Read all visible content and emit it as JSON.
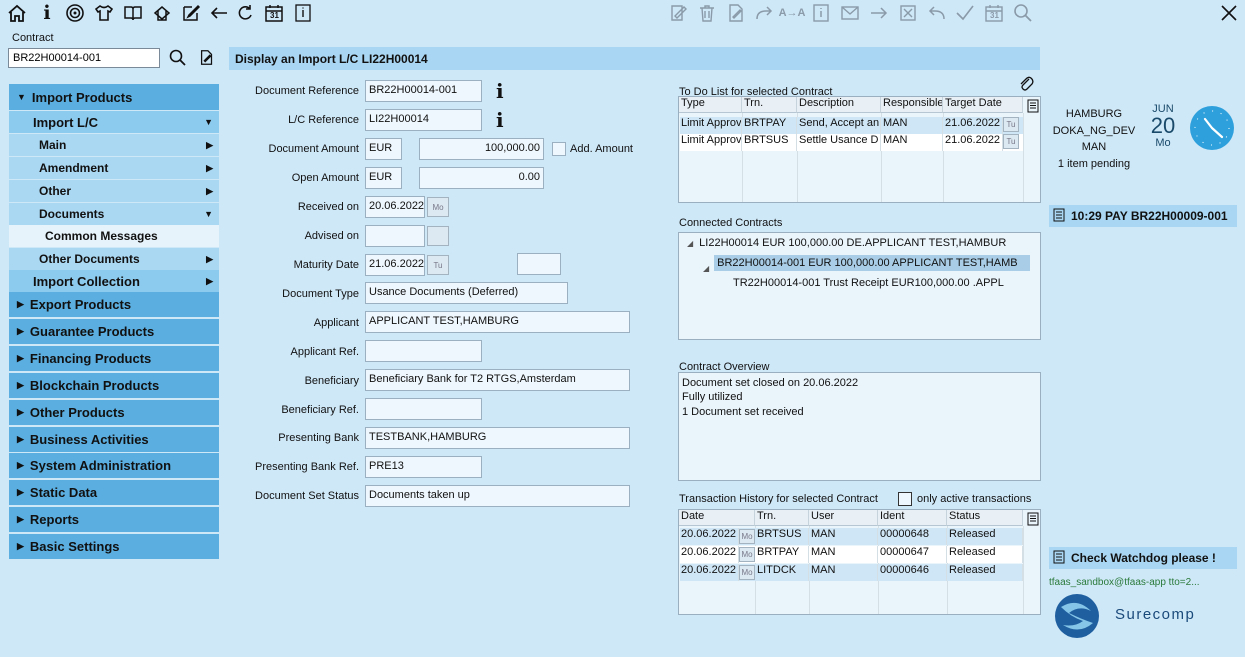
{
  "toolbar": {
    "icons": [
      "home-icon",
      "info-icon",
      "target-icon",
      "tshirt-icon",
      "book-icon",
      "layers-icon",
      "edit-icon",
      "back-arrow-icon",
      "refresh-icon",
      "calendar-icon",
      "notes-icon"
    ],
    "right_icons": [
      "sign-icon",
      "trash-icon",
      "document-sign-icon",
      "forward-icon",
      "transfer-icon",
      "info-doc-icon",
      "mail-icon",
      "arrow-right-icon",
      "cancel-box-icon",
      "undo-icon",
      "check-icon",
      "calendar-31-icon",
      "search-icon"
    ],
    "close_icon": "close-icon",
    "calendar_day": "31"
  },
  "contract": {
    "label": "Contract",
    "value": "BR22H00014-001"
  },
  "nav": {
    "import_products": "Import Products",
    "import_lc": "Import L/C",
    "main": "Main",
    "amendment": "Amendment",
    "other": "Other",
    "documents": "Documents",
    "common_messages": "Common Messages",
    "other_documents": "Other Documents",
    "import_collection": "Import Collection",
    "export_products": "Export Products",
    "guarantee_products": "Guarantee Products",
    "financing_products": "Financing Products",
    "blockchain_products": "Blockchain Products",
    "other_products": "Other Products",
    "business_activities": "Business Activities",
    "system_administration": "System Administration",
    "static_data": "Static Data",
    "reports": "Reports",
    "basic_settings": "Basic Settings"
  },
  "title": "Display an Import L/C LI22H00014",
  "form": {
    "doc_ref_label": "Document Reference",
    "doc_ref_value": "BR22H00014-001",
    "lc_ref_label": "L/C Reference",
    "lc_ref_value": "LI22H00014",
    "doc_amount_label": "Document Amount",
    "doc_amount_ccy": "EUR",
    "doc_amount_value": "100,000.00",
    "add_amount_label": "Add. Amount",
    "open_amount_label": "Open Amount",
    "open_amount_ccy": "EUR",
    "open_amount_value": "0.00",
    "received_label": "Received on",
    "received_value": "20.06.2022",
    "received_day": "Mo",
    "advised_label": "Advised on",
    "maturity_label": "Maturity Date",
    "maturity_value": "21.06.2022",
    "maturity_day": "Tu",
    "doc_type_label": "Document Type",
    "doc_type_value": "Usance Documents (Deferred)",
    "applicant_label": "Applicant",
    "applicant_value": "APPLICANT TEST,HAMBURG",
    "applicant_ref_label": "Applicant Ref.",
    "beneficiary_label": "Beneficiary",
    "beneficiary_value": "Beneficiary Bank for T2 RTGS,Amsterdam",
    "beneficiary_ref_label": "Beneficiary Ref.",
    "presenting_bank_label": "Presenting Bank",
    "presenting_bank_value": "TESTBANK,HAMBURG",
    "presenting_bank_ref_label": "Presenting Bank Ref.",
    "presenting_bank_ref_value": "PRE13",
    "doc_set_status_label": "Document Set Status",
    "doc_set_status_value": "Documents taken up"
  },
  "todo": {
    "label": "To Do List for selected Contract",
    "headers": [
      "Type",
      "Trn.",
      "Description",
      "Responsible",
      "Target Date"
    ],
    "rows": [
      {
        "type": "Limit Approv",
        "trn": "BRTPAY",
        "desc": "Send, Accept an",
        "resp": "MAN",
        "date": "21.06.2022",
        "day": "Tu"
      },
      {
        "type": "Limit Approv",
        "trn": "BRTSUS",
        "desc": "Settle Usance D",
        "resp": "MAN",
        "date": "21.06.2022",
        "day": "Tu"
      }
    ]
  },
  "connected": {
    "label": "Connected Contracts",
    "row1": "LI22H00014 EUR 100,000.00 DE.APPLICANT TEST,HAMBUR",
    "row2": "BR22H00014-001 EUR 100,000.00 APPLICANT TEST,HAMB",
    "row3": "TR22H00014-001 Trust Receipt EUR100,000.00 .APPL"
  },
  "overview": {
    "label": "Contract Overview",
    "line1": "Document set closed on 20.06.2022",
    "line2": "Fully utilized",
    "line3": "1 Document set received"
  },
  "history": {
    "label": "Transaction History for selected Contract",
    "only_active_label": "only active transactions",
    "headers": [
      "Date",
      "Trn.",
      "User",
      "Ident",
      "Status"
    ],
    "rows": [
      {
        "date": "20.06.2022",
        "day": "Mo",
        "trn": "BRTSUS",
        "user": "MAN",
        "ident": "00000648",
        "status": "Released"
      },
      {
        "date": "20.06.2022",
        "day": "Mo",
        "trn": "BRTPAY",
        "user": "MAN",
        "ident": "00000647",
        "status": "Released"
      },
      {
        "date": "20.06.2022",
        "day": "Mo",
        "trn": "LITDCK",
        "user": "MAN",
        "ident": "00000646",
        "status": "Released"
      }
    ]
  },
  "side": {
    "city": "HAMBURG",
    "env": "DOKA_NG_DEV",
    "user": "MAN",
    "pending": "1 item pending",
    "month": "JUN",
    "day": "20",
    "weekday": "Mo",
    "pay_item": "10:29 PAY BR22H00009-001",
    "watchdog": "Check Watchdog please !",
    "session": "tfaas_sandbox@tfaas-app tto=2...",
    "brand": "Surecomp"
  }
}
